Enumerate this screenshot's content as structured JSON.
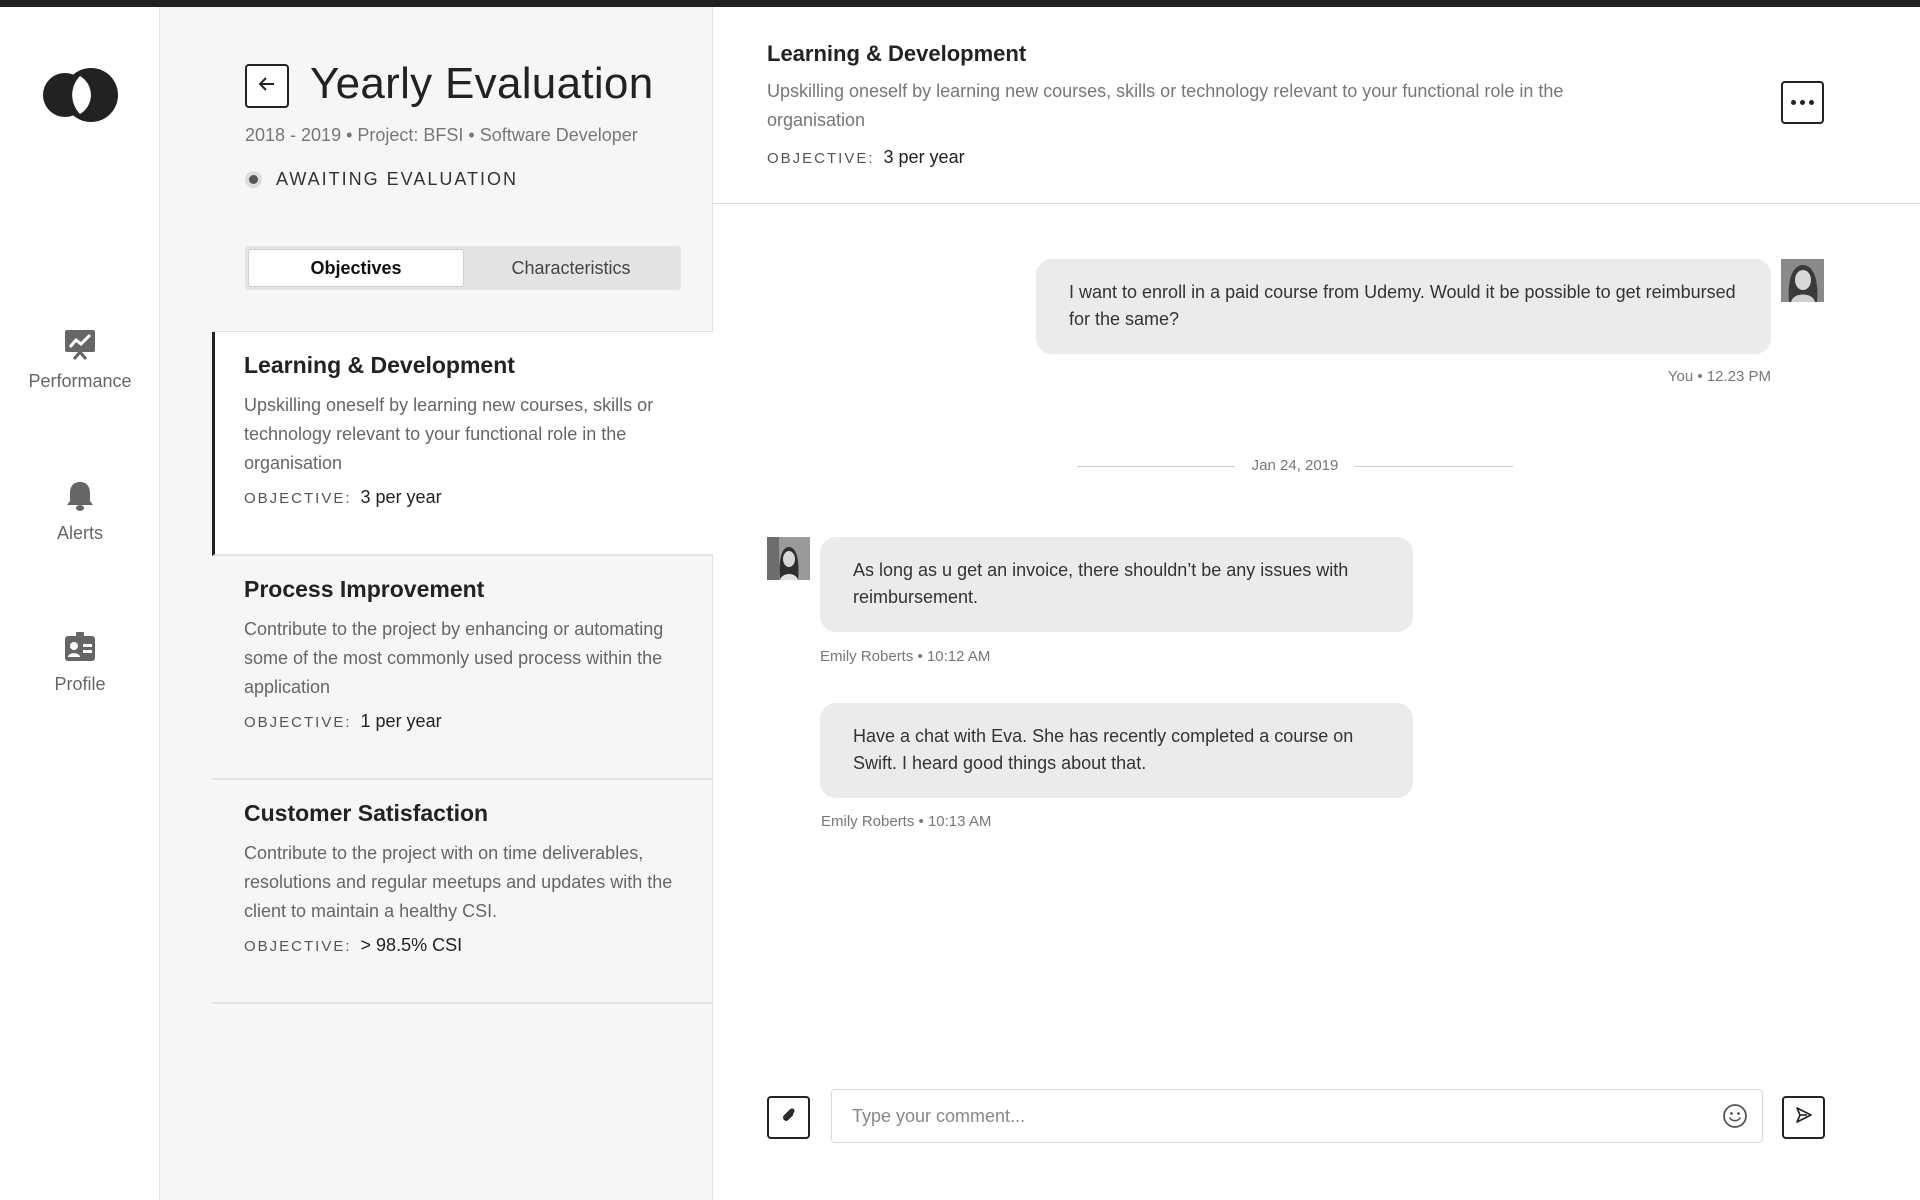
{
  "nav": {
    "items": [
      {
        "label": "Performance",
        "icon": "performance-icon"
      },
      {
        "label": "Alerts",
        "icon": "bell-icon"
      },
      {
        "label": "Profile",
        "icon": "id-card-icon"
      }
    ]
  },
  "evaluation": {
    "title": "Yearly Evaluation",
    "subtitle": "2018 - 2019 • Project: BFSI • Software Developer",
    "status": "AWAITING EVALUATION",
    "tabs": [
      {
        "label": "Objectives",
        "active": true
      },
      {
        "label": "Characteristics",
        "active": false
      }
    ],
    "objectives": [
      {
        "title": "Learning & Development",
        "description": "Upskilling oneself by learning new courses, skills or technology relevant to your functional role in the organisation",
        "objective_label": "OBJECTIVE:",
        "objective_value": "3 per year",
        "active": true
      },
      {
        "title": "Process Improvement",
        "description": "Contribute to the project by enhancing or automating some of the most commonly used process within the application",
        "objective_label": "OBJECTIVE:",
        "objective_value": "1 per year",
        "active": false
      },
      {
        "title": "Customer Satisfaction",
        "description": "Contribute to the project with on time deliverables, resolutions and regular meetups and updates with the client to maintain a healthy CSI.",
        "objective_label": "OBJECTIVE:",
        "objective_value": "> 98.5% CSI",
        "active": false
      }
    ]
  },
  "detail": {
    "title": "Learning & Development",
    "description": "Upskilling oneself by learning new courses, skills or technology relevant to your functional role in the organisation",
    "objective_label": "OBJECTIVE:",
    "objective_value": "3 per year"
  },
  "chat": {
    "messages": [
      {
        "text": "I want to enroll in a paid course from Udemy. Would it be possible to get reimbursed for the same?",
        "meta": "You • 12.23 PM",
        "from": "You"
      },
      {
        "text": "As long as u get an invoice, there shouldn’t be any issues with reimbursement.",
        "meta": "Emily Roberts •  10:12 AM",
        "from": "Emily Roberts"
      },
      {
        "text": "Have a chat with Eva. She has recently completed a course on Swift. I heard good things about that.",
        "meta": "Emily Roberts •  10:13 AM",
        "from": "Emily Roberts"
      }
    ],
    "date_divider": "Jan 24, 2019",
    "composer_placeholder": "Type your comment..."
  },
  "colors": {
    "accent": "#222222",
    "left_pane_bg": "#f6f6f6",
    "bubble_bg": "#ebebeb",
    "muted_text": "#777777"
  }
}
